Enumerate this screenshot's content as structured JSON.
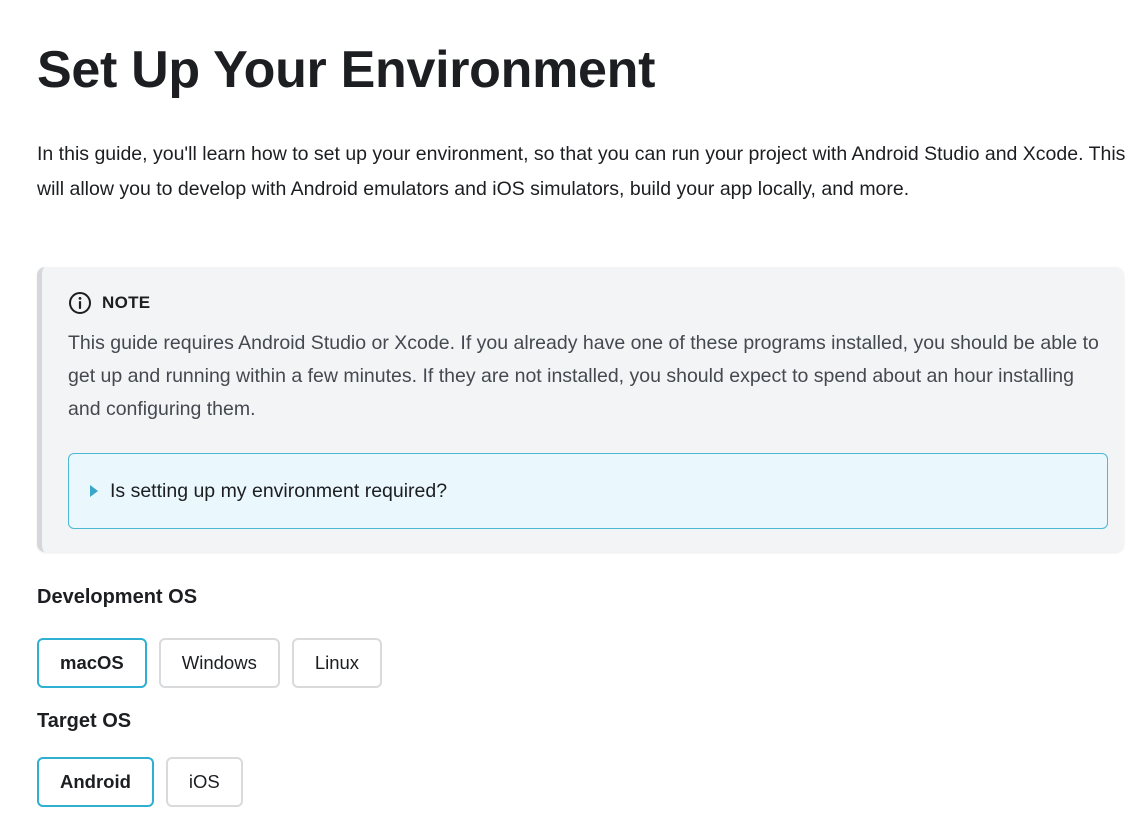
{
  "header": {
    "title": "Set Up Your Environment"
  },
  "intro": {
    "text": "In this guide, you'll learn how to set up your environment, so that you can run your project with Android Studio and Xcode. This will allow you to develop with Android emulators and iOS simulators, build your app locally, and more."
  },
  "note": {
    "icon": "info-icon",
    "label": "NOTE",
    "body": "This guide requires Android Studio or Xcode. If you already have one of these programs installed, you should be able to get up and running within a few minutes. If they are not installed, you should expect to spend about an hour installing and configuring them.",
    "details": {
      "summary": "Is setting up my environment required?",
      "expanded": false
    }
  },
  "development_os": {
    "label": "Development OS",
    "options": [
      "macOS",
      "Windows",
      "Linux"
    ],
    "selected": "macOS"
  },
  "target_os": {
    "label": "Target OS",
    "options": [
      "Android",
      "iOS"
    ],
    "selected": "Android"
  },
  "colors": {
    "accent": "#2fb0d3",
    "note_background": "#f3f4f6",
    "details_background": "#eaf7fd",
    "text": "#1c1e21"
  }
}
